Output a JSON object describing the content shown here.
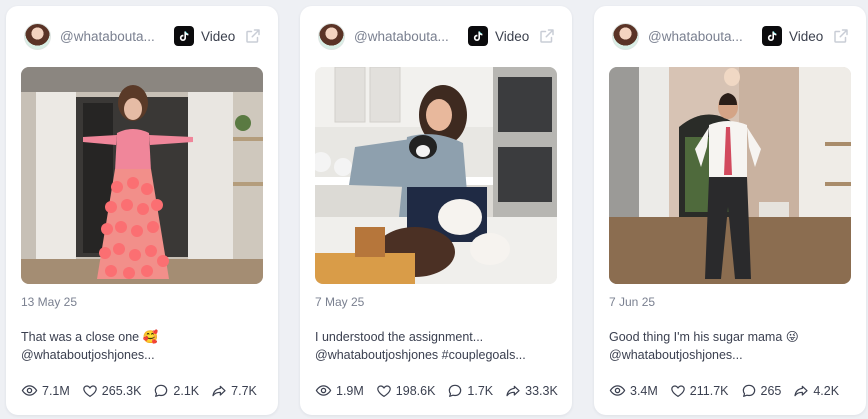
{
  "posts": [
    {
      "handle": "@whatabouta...",
      "platform_label": "Video",
      "date": "13 May 25",
      "caption_line1": "That was a close one 🥰",
      "caption_line2": "@whataboutjoshjones...",
      "views": "7.1M",
      "likes": "265.3K",
      "comments": "2.1K",
      "shares": "7.7K"
    },
    {
      "handle": "@whatabouta...",
      "platform_label": "Video",
      "date": "7 May 25",
      "caption_line1": "I understood the assignment...",
      "caption_line2": "@whataboutjoshjones #couplegoals...",
      "views": "1.9M",
      "likes": "198.6K",
      "comments": "1.7K",
      "shares": "33.3K"
    },
    {
      "handle": "@whatabouta...",
      "platform_label": "Video",
      "date": "7 Jun 25",
      "caption_line1": "Good thing I'm his sugar mama 😜",
      "caption_line2": "@whataboutjoshjones...",
      "views": "3.4M",
      "likes": "211.7K",
      "comments": "265",
      "shares": "4.2K"
    }
  ],
  "icons": {
    "platform": "tiktok-icon",
    "open": "external-link-icon",
    "views": "eye-icon",
    "likes": "heart-icon",
    "comments": "comment-icon",
    "shares": "share-icon"
  },
  "colors": {
    "background": "#eef0f4",
    "card": "#ffffff",
    "muted_text": "#7a8090",
    "body_text": "#3b4050"
  }
}
